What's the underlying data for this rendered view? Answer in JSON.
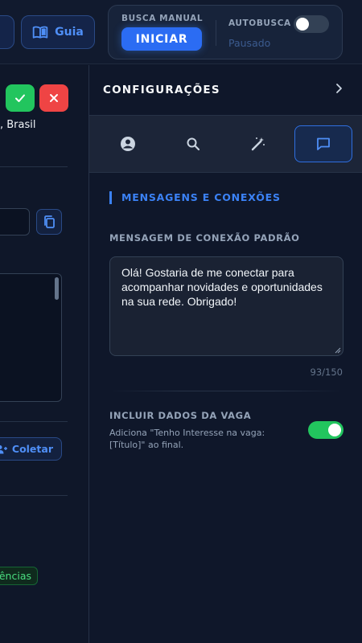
{
  "topbar": {
    "guia_label": "Guia",
    "busca_manual_label": "BUSCA MANUAL",
    "iniciar_label": "INICIAR",
    "autobusca_label": "AUTOBUSCA",
    "autobusca_status": "Pausado",
    "autobusca_enabled": false
  },
  "left_panel": {
    "location_text": ", Brasil",
    "coletar_label": "Coletar",
    "badge_text": "ências"
  },
  "settings": {
    "title": "CONFIGURAÇÕES",
    "tabs": [
      {
        "icon": "account-circle-icon",
        "active": false
      },
      {
        "icon": "search-icon",
        "active": false
      },
      {
        "icon": "magic-wand-icon",
        "active": false
      },
      {
        "icon": "chat-bubble-icon",
        "active": true
      }
    ],
    "section_title": "MENSAGENS E CONEXÕES",
    "default_message_label": "MENSAGEM DE CONEXÃO PADRÃO",
    "default_message_value": "Olá! Gostaria de me conectar para acompanhar novidades e oportunidades na sua rede. Obrigado!",
    "char_counter": "93/150",
    "include_job_label": "INCLUIR DADOS DA VAGA",
    "include_job_description": "Adiciona \"Tenho Interesse na vaga: [Título]\" ao final.",
    "include_job_enabled": true
  },
  "colors": {
    "accent_blue": "#3b82f6",
    "success_green": "#22c55e",
    "danger_red": "#ef4444",
    "background": "#0f172a"
  }
}
